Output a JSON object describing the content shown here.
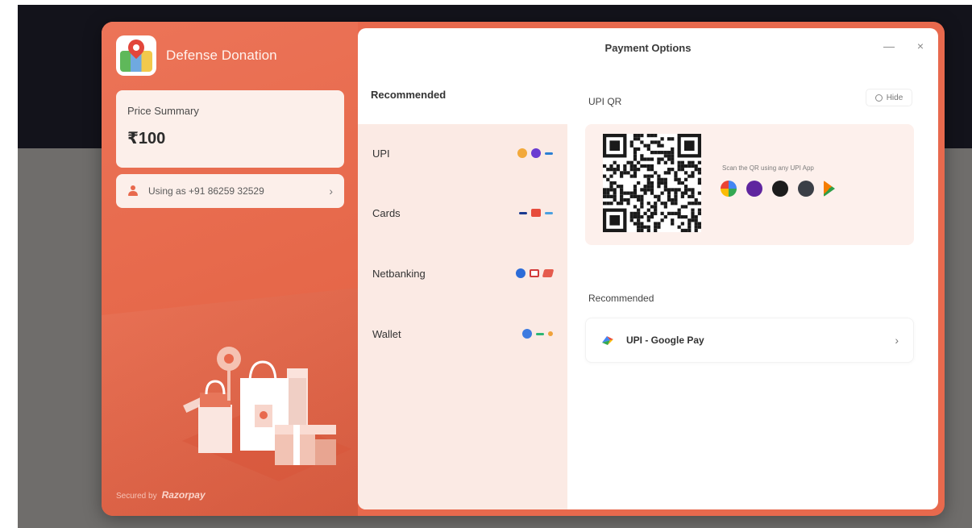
{
  "app": {
    "brand_name": "Defense Donation",
    "window_title": "Payment Options"
  },
  "colors": {
    "accent": "#e8694d",
    "panel_tint": "#fbeae4",
    "backdrop_dark": "#13131b",
    "backdrop_grey": "#6f6d6b"
  },
  "summary": {
    "label": "Price Summary",
    "amount": "₹100",
    "user_text": "Using as +91 86259 32529",
    "user_chevron": "›"
  },
  "footer": {
    "secured_text": "Secured by",
    "provider": "Razorpay"
  },
  "header": {
    "minimize_icon": "—",
    "close_icon": "×"
  },
  "methods": {
    "title": "Recommended",
    "items": [
      {
        "label": "UPI",
        "icons": [
          "gpay-icon",
          "phonepe-icon",
          "paytm-icon"
        ]
      },
      {
        "label": "Cards",
        "icons": [
          "visa-icon",
          "mastercard-icon",
          "rupay-icon"
        ]
      },
      {
        "label": "Netbanking",
        "icons": [
          "bank-icon",
          "bank-icon",
          "bank-icon"
        ]
      },
      {
        "label": "Wallet",
        "icons": [
          "wallet-icon",
          "wallet-icon",
          "wallet-icon"
        ]
      }
    ]
  },
  "upi_qr": {
    "title": "UPI QR",
    "hide_label": "Hide",
    "scan_text": "Scan the QR using any UPI App",
    "apps": [
      "gpay-icon",
      "phonepe-icon",
      "app-icon",
      "app-icon",
      "bhim-icon"
    ]
  },
  "recommended": {
    "title": "Recommended",
    "item_label": "UPI - Google Pay",
    "item_chevron": "›"
  }
}
